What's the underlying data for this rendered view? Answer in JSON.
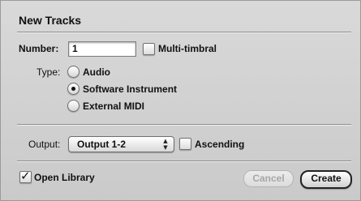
{
  "dialog": {
    "title": "New Tracks"
  },
  "number": {
    "label": "Number:",
    "value": "1"
  },
  "multi_timbral": {
    "label": "Multi-timbral",
    "checked": false
  },
  "type": {
    "label": "Type:",
    "options": [
      {
        "label": "Audio",
        "selected": false
      },
      {
        "label": "Software Instrument",
        "selected": true
      },
      {
        "label": "External MIDI",
        "selected": false
      }
    ]
  },
  "output": {
    "label": "Output:",
    "selected": "Output 1-2"
  },
  "ascending": {
    "label": "Ascending",
    "checked": false
  },
  "open_library": {
    "label": "Open Library",
    "checked": true
  },
  "buttons": {
    "cancel": "Cancel",
    "create": "Create"
  },
  "icons": {
    "checkmark": "checkmark-icon",
    "popup_arrows": "up-down-arrows-icon"
  }
}
